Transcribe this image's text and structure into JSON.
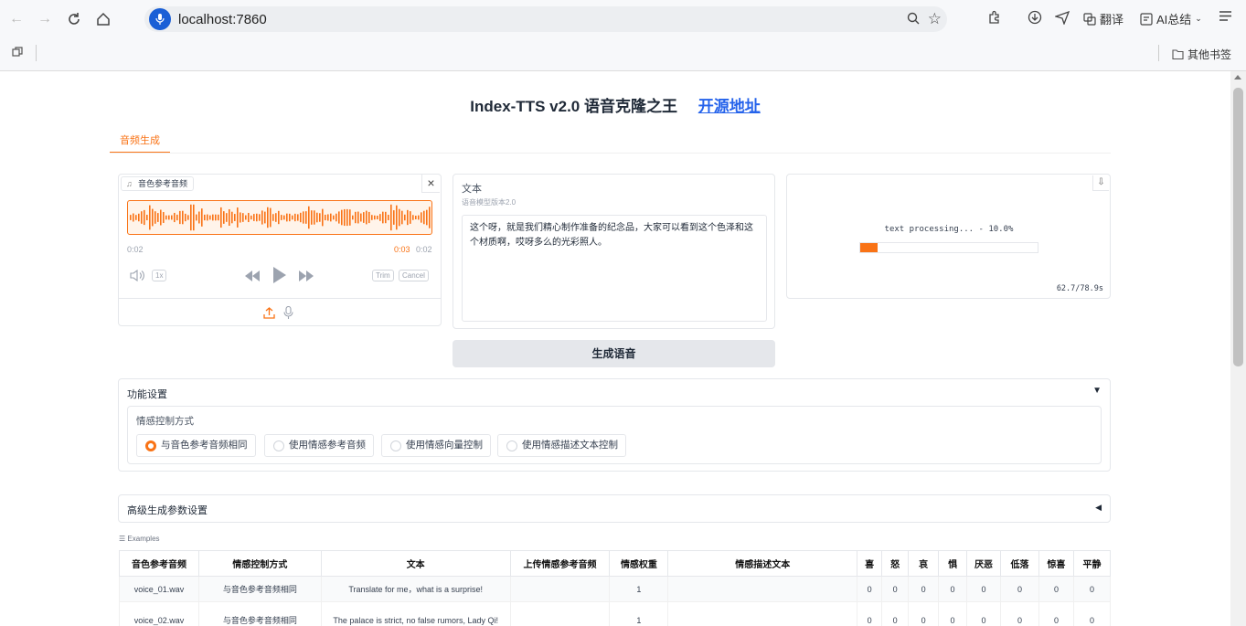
{
  "browser": {
    "url": "localhost:7860",
    "translate_label": "翻译",
    "ai_label": "AI总结",
    "bookmarks_label": "其他书签"
  },
  "header": {
    "title": "Index-TTS v2.0 语音克隆之王",
    "link_text": "开源地址"
  },
  "tabs": [
    "音频生成"
  ],
  "reference_audio": {
    "label": "音色参考音频",
    "time_left": "0:02",
    "time_current": "0:03",
    "time_total": "0:02",
    "speed_label": "1x",
    "trim_label": "Trim",
    "cancel_label": "Cancel"
  },
  "text_input": {
    "label": "文本",
    "sublabel": "语音模型版本2.0",
    "value": "这个呀，就是我们精心制作准备的纪念品，大家可以看到这个色泽和这个材质啊，哎呀多么的光彩照人。"
  },
  "output": {
    "progress_text": "text processing... - 10.0%",
    "progress": 0.1,
    "timing": "62.7/78.9s"
  },
  "generate_button": "生成语音",
  "feature_settings": {
    "title": "功能设置",
    "arrow": "▼",
    "emotion_label": "情感控制方式",
    "options": [
      "与音色参考音频相同",
      "使用情感参考音频",
      "使用情感向量控制",
      "使用情感描述文本控制"
    ],
    "selected": 0
  },
  "advanced_settings": {
    "title": "高级生成参数设置",
    "arrow": "◀"
  },
  "examples": {
    "label": "Examples",
    "headers": [
      "音色参考音频",
      "情感控制方式",
      "文本",
      "上传情感参考音频",
      "情感权重",
      "情感描述文本",
      "喜",
      "怒",
      "哀",
      "惧",
      "厌恶",
      "低落",
      "惊喜",
      "平静"
    ],
    "rows": [
      [
        "voice_01.wav",
        "与音色参考音频相同",
        "Translate for me，what is a surprise!",
        "",
        "1",
        "",
        "0",
        "0",
        "0",
        "0",
        "0",
        "0",
        "0",
        "0"
      ],
      [
        "voice_02.wav",
        "与音色参考音频相同",
        "The palace is strict, no false rumors, Lady Qi!",
        "",
        "1",
        "",
        "0",
        "0",
        "0",
        "0",
        "0",
        "0",
        "0",
        "0"
      ]
    ]
  }
}
